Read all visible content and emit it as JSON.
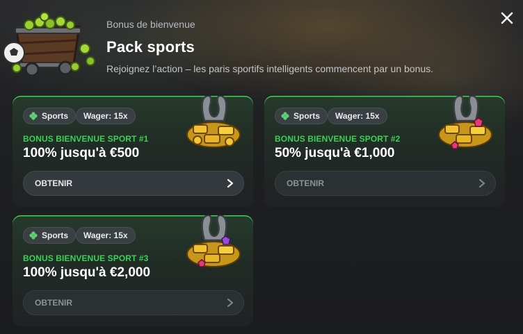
{
  "header": {
    "subtitle": "Bonus de bienvenue",
    "title": "Pack sports",
    "description": "Rejoignez l’action – les paris sportifs intelligents commencent par un bonus.",
    "icon": "mine-cart-icon",
    "close_icon": "close-icon"
  },
  "cards": [
    {
      "tags": [
        "Sports",
        "Wager: 15x"
      ],
      "label": "BONUS BIENVENUE SPORT #1",
      "amount": "100% jusqu'à €500",
      "button": "OBTENIR"
    },
    {
      "tags": [
        "Sports",
        "Wager: 15x"
      ],
      "label": "BONUS BIENVENUE SPORT #2",
      "amount": "50% jusqu'à €1,000",
      "button": "OBTENIR"
    },
    {
      "tags": [
        "Sports",
        "Wager: 15x"
      ],
      "label": "BONUS BIENVENUE SPORT #3",
      "amount": "100% jusqu'à €2,000",
      "button": "OBTENIR"
    }
  ],
  "colors": {
    "accent": "#3bd157",
    "background": "#1b1c20",
    "card": "#222a25"
  }
}
